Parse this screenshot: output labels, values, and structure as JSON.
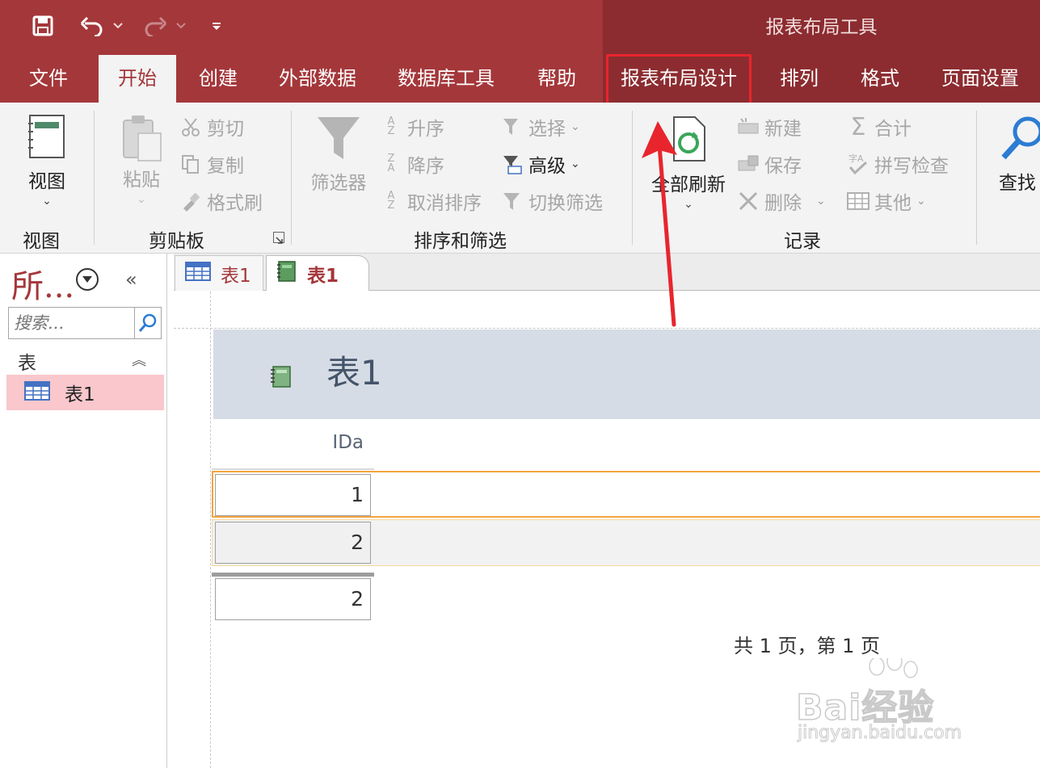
{
  "context_tab_title": "报表布局工具",
  "quick_access": {
    "save_icon": "save-icon",
    "undo_icon": "undo-icon",
    "redo_icon": "redo-icon",
    "customize_icon": "customize-qat-icon"
  },
  "tabs": [
    {
      "label": "文件"
    },
    {
      "label": "开始",
      "active": true
    },
    {
      "label": "创建"
    },
    {
      "label": "外部数据"
    },
    {
      "label": "数据库工具"
    },
    {
      "label": "帮助"
    },
    {
      "label": "报表布局设计",
      "highlighted": true
    },
    {
      "label": "排列"
    },
    {
      "label": "格式"
    },
    {
      "label": "页面设置"
    }
  ],
  "ribbon": {
    "view": {
      "button": "视图",
      "group": "视图"
    },
    "clipboard": {
      "paste": "粘贴",
      "cut": "剪切",
      "copy": "复制",
      "format_painter": "格式刷",
      "group": "剪贴板"
    },
    "sort_filter": {
      "filter": "筛选器",
      "ascending": "升序",
      "descending": "降序",
      "clear_sort": "取消排序",
      "selection": "选择",
      "advanced": "高级",
      "toggle_filter": "切换筛选",
      "group": "排序和筛选"
    },
    "records": {
      "refresh_all": "全部刷新",
      "new": "新建",
      "save": "保存",
      "delete": "删除",
      "totals": "合计",
      "spelling": "拼写检查",
      "more": "其他",
      "group": "记录"
    },
    "find": {
      "find": "查找"
    }
  },
  "nav_pane": {
    "title": "所...",
    "search_placeholder": "搜索...",
    "group": "表",
    "items": [
      {
        "label": "表1",
        "selected": true
      }
    ]
  },
  "doc_tabs": [
    {
      "label": "表1",
      "icon": "table-icon"
    },
    {
      "label": "表1",
      "icon": "report-icon",
      "active": true
    }
  ],
  "report": {
    "title": "表1",
    "column_header": "IDa",
    "rows": [
      "1",
      "2"
    ],
    "total": "2",
    "page_footer": "共 1 页，第 1 页"
  },
  "watermark": {
    "brand": "Bai经验",
    "url": "jingyan.baidu.com"
  },
  "colors": {
    "access_red": "#a4373a",
    "context_band": "#8c2c30",
    "highlight_box": "#e8252d",
    "report_header_bg": "#d6dce5",
    "selected_row_border": "#f3a43e",
    "nav_selected": "#f9c7cc"
  }
}
